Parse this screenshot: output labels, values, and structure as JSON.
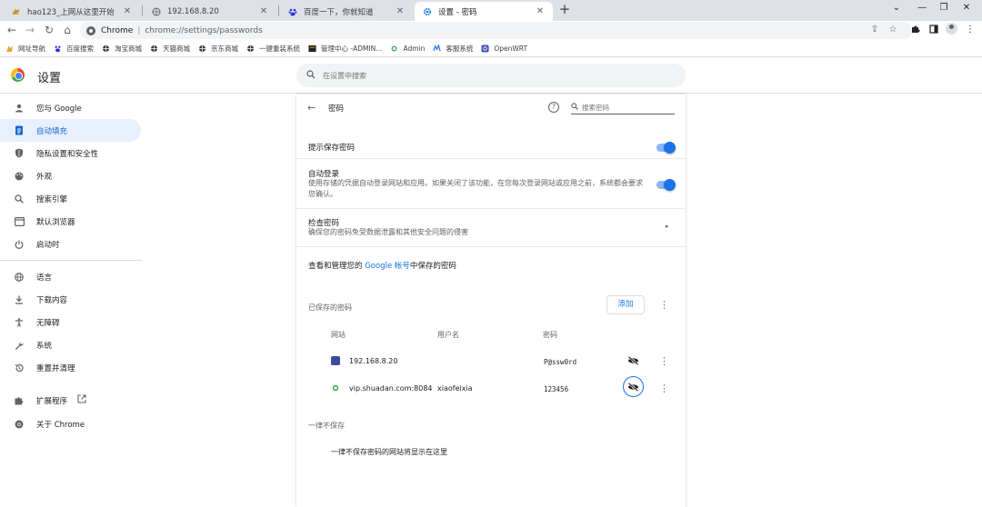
{
  "browser": {
    "tabs": [
      {
        "title": "hao123_上网从这里开始",
        "icon": "hao123-icon"
      },
      {
        "title": "192.168.8.20",
        "icon": "globe-icon"
      },
      {
        "title": "百度一下，你就知道",
        "icon": "baidu-icon"
      },
      {
        "title": "设置 - 密码",
        "icon": "settings-gear-icon",
        "active": true
      }
    ],
    "address": {
      "prefix": "Chrome",
      "url": "chrome://settings/passwords"
    },
    "bookmarks": [
      {
        "label": "网址导航",
        "icon": "hao123-icon"
      },
      {
        "label": "百度搜索",
        "icon": "baidu-icon"
      },
      {
        "label": "淘宝商城",
        "icon": "globe-icon"
      },
      {
        "label": "天猫商城",
        "icon": "globe-icon"
      },
      {
        "label": "京东商城",
        "icon": "globe-icon"
      },
      {
        "label": "一键重装系统",
        "icon": "globe-icon"
      },
      {
        "label": "管理中心 -ADMIN...",
        "icon": "folder-icon"
      },
      {
        "label": "Admin",
        "icon": "dot-icon"
      },
      {
        "label": "客服系统",
        "icon": "chat-icon"
      },
      {
        "label": "OpenWRT",
        "icon": "openwrt-icon"
      }
    ]
  },
  "settings": {
    "title": "设置",
    "search_placeholder": "在设置中搜索",
    "nav": [
      {
        "label": "您与 Google",
        "icon": "person-icon"
      },
      {
        "label": "自动填充",
        "icon": "autofill-icon",
        "active": true
      },
      {
        "label": "隐私设置和安全性",
        "icon": "shield-icon"
      },
      {
        "label": "外观",
        "icon": "palette-icon"
      },
      {
        "label": "搜索引擎",
        "icon": "search-icon"
      },
      {
        "label": "默认浏览器",
        "icon": "browser-icon"
      },
      {
        "label": "启动时",
        "icon": "power-icon"
      },
      {
        "label": "语言",
        "icon": "language-icon"
      },
      {
        "label": "下载内容",
        "icon": "download-icon"
      },
      {
        "label": "无障碍",
        "icon": "accessibility-icon"
      },
      {
        "label": "系统",
        "icon": "wrench-icon"
      },
      {
        "label": "重置并清理",
        "icon": "reset-icon"
      },
      {
        "label": "扩展程序",
        "icon": "puzzle-icon"
      },
      {
        "label": "关于 Chrome",
        "icon": "chrome-icon"
      }
    ]
  },
  "passwords": {
    "title": "密码",
    "search_placeholder": "搜索密码",
    "offer_to_save": {
      "label": "提示保存密码",
      "enabled": true
    },
    "auto_signin": {
      "label": "自动登录",
      "description": "使用存储的凭据自动登录网站和应用。如果关闭了该功能，在您每次登录网站或应用之前，系统都会要求您确认。",
      "enabled": true
    },
    "check": {
      "label": "检查密码",
      "description": "确保您的密码免受数据泄露和其他安全问题的侵害"
    },
    "manage": {
      "prefix": "查看和管理您的 ",
      "link": "Google 帐号",
      "suffix": "中保存的密码"
    },
    "saved_label": "已保存的密码",
    "add_button": "添加",
    "columns": {
      "site": "网站",
      "username": "用户名",
      "password": "密码"
    },
    "entries": [
      {
        "site": "192.168.8.20",
        "username": "",
        "password": "P@ssw0rd"
      },
      {
        "site": "vip.shuadan.com:8084",
        "username": "xiaofeixia",
        "password": "123456"
      }
    ],
    "never_label": "一律不保存",
    "never_empty": "一律不保存密码的网站将显示在这里"
  }
}
